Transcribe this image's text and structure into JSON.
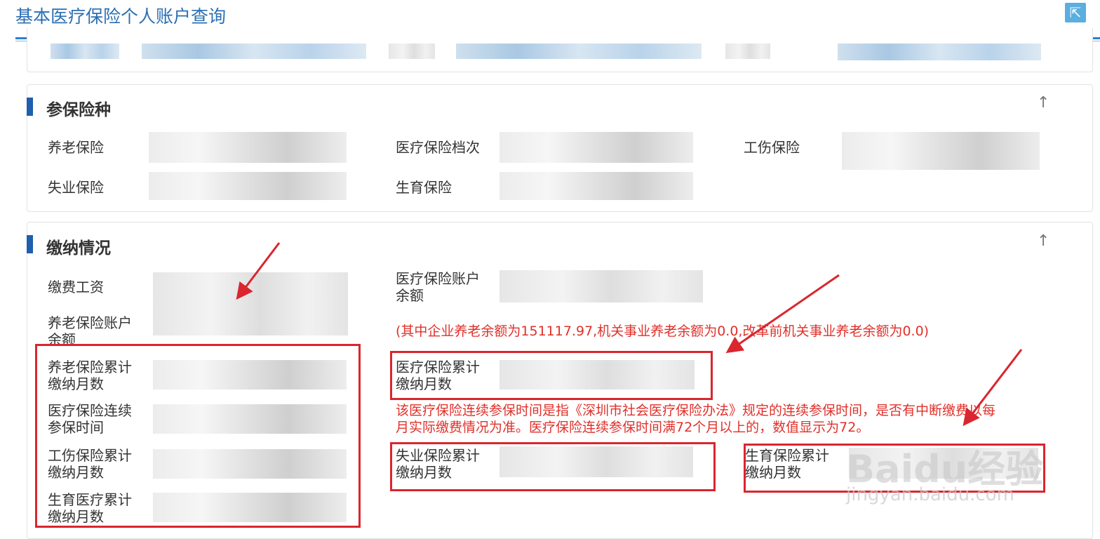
{
  "page": {
    "title": "基本医疗保险个人账户查询",
    "export_icon": "external-link-icon"
  },
  "insured_types": {
    "title": "参保险种",
    "collapse_icon": "arrow-up-icon",
    "fields": [
      {
        "label": "养老保险"
      },
      {
        "label": "医疗保险档次"
      },
      {
        "label": "工伤保险"
      },
      {
        "label": "失业保险"
      },
      {
        "label": "生育保险"
      }
    ]
  },
  "payment": {
    "title": "缴纳情况",
    "collapse_icon": "arrow-up-icon",
    "labels": {
      "wage": "缴费工资",
      "medical_balance_1": "医疗保险账户",
      "medical_balance_2": "余额",
      "pension_balance_1": "养老保险账户",
      "pension_balance_2": "余额",
      "pension_months_1": "养老保险累计",
      "pension_months_2": "缴纳月数",
      "medical_months_1": "医疗保险累计",
      "medical_months_2": "缴纳月数",
      "medical_continuous_1": "医疗保险连续",
      "medical_continuous_2": "参保时间",
      "injury_months_1": "工伤保险累计",
      "injury_months_2": "缴纳月数",
      "unemployment_months_1": "失业保险累计",
      "unemployment_months_2": "缴纳月数",
      "maternity_months_1": "生育保险累计",
      "maternity_months_2": "缴纳月数",
      "maternity_medical_1": "生育医疗累计",
      "maternity_medical_2": "缴纳月数"
    },
    "pension_note": "(其中企业养老余额为151117.97,机关事业养老余额为0.0,改革前机关事业养老余额为0.0)",
    "medical_note_1": "该医疗保险连续参保时间是指《深圳市社会医疗保险办法》规定的连续参保时间，是否有中断缴费以每",
    "medical_note_2": "月实际缴费情况为准。医疗保险连续参保时间满72个月以上的，数值显示为72。"
  },
  "watermark": {
    "brand": "Baidu经验",
    "site": "jingyan.baidu.com"
  }
}
